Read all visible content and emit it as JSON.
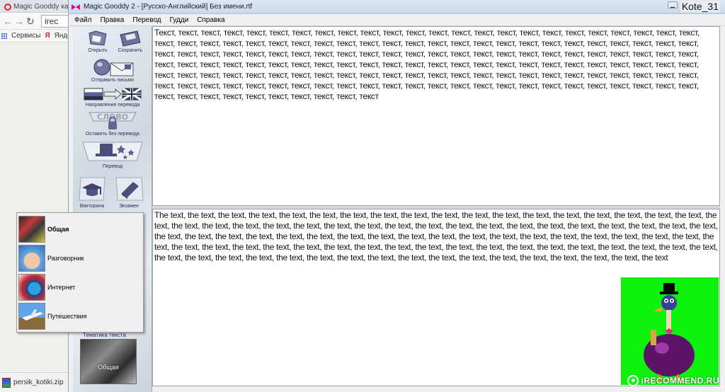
{
  "browser": {
    "tab_title": "Magic Gooddy как",
    "url_text": "irec",
    "bookmarks": [
      "Сервисы",
      "Яндекс"
    ],
    "download_file": "persik_kotiki.zip"
  },
  "window": {
    "title": "Magic Gooddy 2 - [Русско-Английский]  Без имени.rtf",
    "user_label": "Kote_31",
    "minimize_symbol": "▁"
  },
  "menu": [
    "Файл",
    "Правка",
    "Перевод",
    "Гудди",
    "Справка"
  ],
  "toolbar": {
    "open": "Открыть",
    "save": "Сохранить",
    "send_letter": "Отправить письмо",
    "direction": "Направление перевода",
    "word_badge": "СЛОВО",
    "keep_word": "Оставить без перевода",
    "translate": "Перевод",
    "quiz": "Викторина",
    "exams": "Экзамен",
    "topic_label": "Тематика текста",
    "topic_current": "Общая"
  },
  "editor": {
    "source_text": "Текст, текст, текст, текст, текст, текст, текст, текст, текст, текст, текст, текст, текст, текст, текст, текст, текст, текст, текст, текст, текст, текст, текст, текст, текст, текст, текст, текст, текст, текст, текст, текст, текст, текст, текст, текст, текст, текст, текст, текст, текст, текст, текст, текст, текст, текст, текст, текст, текст, текст, текст, текст, текст, текст, текст, текст, текст, текст, текст, текст, текст, текст, текст, текст, текст, текст, текст, текст, текст, текст, текст, текст, текст, текст, текст, текст, текст, текст, текст, текст, текст, текст, текст, текст, текст, текст, текст, текст, текст, текст, текст, текст, текст, текст, текст, текст, текст, текст, текст, текст, текст, текст, текст, текст, текст, текст, текст, текст, текст, текст, текст, текст, текст, текст, текст, текст, текст, текст, текст, текст, текст, текст, текст, текст, текст, текст, текст, текст, текст, текст, текст, текст, текст, текст, текст, текст, текст, текст, текст, текст, текст, текст, текст, текст, текст, текст, текст, текст, текст, текст, текст, текст, текст, текст",
    "target_text": "The text, the text, the text, the text, the text, the text, the text, the text, the text, the text, the text, the text, the text, the text, the text, the text, the text, the text, the text, the text, the text, the text, the text, the text, the text, the text, the text, the text, the text, the text, the text, the text, the text, the text, the text, the text, the text, the text, the text, the text, the text, the text, the text, the text, the text, the text, the text, the text, the text, the text, the text, the text, the text, the text, the text, the text, the text, the text, the text, the text, the text, the text, the text, the text, the text, the text, the text, the text, the text, the text, the text, the text, the text, the text, the text, the text, the text, the text, the text, the text, the text, the text, the text, the text, the text, the text, the text, the text, the text, the text, the text"
  },
  "topic_menu": [
    {
      "label": "Общая",
      "selected": true
    },
    {
      "label": "Разговорник",
      "selected": false
    },
    {
      "label": "Интернет",
      "selected": false
    },
    {
      "label": "Путешествия",
      "selected": false
    }
  ],
  "watermark": "iRECOMMEND.RU",
  "colors": {
    "mascot_bg": "#0df20d",
    "title_bar": "#c9d9ec",
    "toolbar_label": "#2e2e5c"
  }
}
